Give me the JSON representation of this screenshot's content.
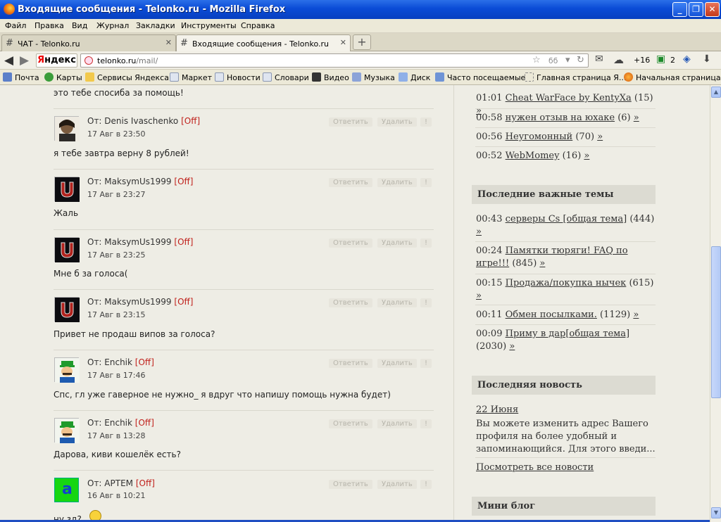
{
  "window": {
    "title": "Входящие сообщения - Telonko.ru - Mozilla Firefox",
    "min": "_",
    "max": "❐",
    "close": "✕"
  },
  "menu": [
    "Файл",
    "Правка",
    "Вид",
    "Журнал",
    "Закладки",
    "Инструменты",
    "Справка"
  ],
  "tabs": [
    {
      "label": "ЧАТ - Telonko.ru",
      "icon": "#",
      "close": "✕"
    },
    {
      "label": "Входящие сообщения - Telonko.ru",
      "icon": "#",
      "close": "✕"
    }
  ],
  "new_tab": "+",
  "nav": {
    "back": "◀",
    "forward": "▶",
    "yandex_y": "Я",
    "yandex_rest": "ндекс",
    "url_host": "telonko.ru",
    "url_path": "/mail/",
    "star": "☆",
    "reader": "ϭϭ",
    "dropdown": "▾",
    "reload": "↻",
    "mail": "✉",
    "weather": "☁",
    "weather_temp": "+16",
    "badge_count": "2",
    "badge_icon": "▣",
    "shield": "◈",
    "download": "⬇"
  },
  "bookmarks": [
    "Почта",
    "Карты",
    "Сервисы Яндекса",
    "Маркет",
    "Новости",
    "Словари",
    "Видео",
    "Музыка",
    "Диск",
    "Часто посещаемые",
    "Главная страница Я...",
    "Начальная страница"
  ],
  "actions": {
    "reply": "Ответить",
    "delete": "Удалить",
    "flag": "!"
  },
  "messages": {
    "top_text": "это тебе спосиба за помощь!",
    "items": [
      {
        "from": "От: Denis Ivaschenko",
        "status": "[Off]",
        "date": "17 Авг в 23:50",
        "text": "я тебе завтра верну 8 рублей!"
      },
      {
        "from": "От: MaksymUs1999",
        "status": "[Off]",
        "date": "17 Авг в 23:27",
        "text": "Жаль"
      },
      {
        "from": "От: MaksymUs1999",
        "status": "[Off]",
        "date": "17 Авг в 23:25",
        "text": "Мне б за голоса("
      },
      {
        "from": "От: MaksymUs1999",
        "status": "[Off]",
        "date": "17 Авг в 23:15",
        "text": "Привет не продаш випов за голоса?"
      },
      {
        "from": "От: Enchik",
        "status": "[Off]",
        "date": "17 Авг в 17:46",
        "text": "Спс, гл уже гаверное не нужно_ я вдруг что напишу помощь нужна будет)"
      },
      {
        "from": "От: Enchik",
        "status": "[Off]",
        "date": "17 Авг в 13:28",
        "text": "Дарова, киви кошелёк есть?"
      },
      {
        "from": "От: АРТЕМ",
        "status": "[Off]",
        "date": "16 Авг в 10:21",
        "text": "ну зд?"
      }
    ],
    "avatar_letter": "a"
  },
  "sidebar": {
    "top_items": [
      {
        "time": "01:01",
        "link": "Cheat WarFace by KentyXa",
        "count": "(15)",
        "more": "»"
      },
      {
        "time": "00:58",
        "link": "нужен отзыв на юхаке",
        "count": "(6)",
        "more": "»"
      },
      {
        "time": "00:56",
        "link": "Неугомонный",
        "count": "(70)",
        "more": "»"
      },
      {
        "time": "00:52",
        "link": "WebMomey",
        "count": "(16)",
        "more": "»"
      }
    ],
    "important_title": "Последние важные темы",
    "important": [
      {
        "time": "00:43",
        "link": "серверы Cs [общая тема]",
        "count": "(444)",
        "more": "»"
      },
      {
        "time": "00:24",
        "link": "Памятки тюряги! FAQ по игре!!!",
        "count": "(845)",
        "more": "»"
      },
      {
        "time": "00:15",
        "link": "Продажа/покупка нычек",
        "count": "(615)",
        "more": "»"
      },
      {
        "time": "00:11",
        "link": "Обмен посылками.",
        "count": "(1129)",
        "more": "»"
      },
      {
        "time": "00:09",
        "link": "Приму в дар[общая тема]",
        "count": "(2030)",
        "more": "»"
      }
    ],
    "news_title": "Последняя новость",
    "news_date": "22 Июня",
    "news_text": "Вы можете изменить адрес Вашего профиля на более удобный и запоминающийся. Для этого введи...",
    "news_all": "Посмотреть все новости",
    "blog_title": "Мини блог"
  },
  "scrollbar": {
    "up": "▲",
    "down": "▼"
  }
}
